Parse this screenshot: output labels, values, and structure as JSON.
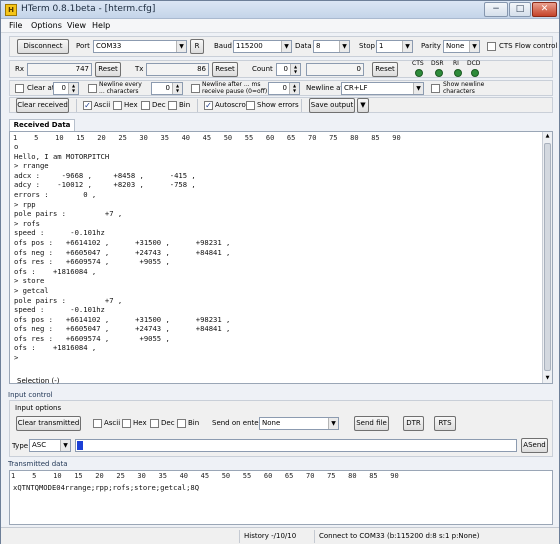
{
  "window": {
    "title": "HTerm 0.8.1beta - [hterm.cfg]",
    "app_icon_glyph": "H",
    "minimize_glyph": "−",
    "maximize_glyph": "□",
    "close_glyph": "✕"
  },
  "menu": [
    "File",
    "Options",
    "View",
    "Help"
  ],
  "connection": {
    "disconnect_label": "Disconnect",
    "port_label": "Port",
    "port_value": "COM33",
    "refresh_label": "R",
    "baud_label": "Baud",
    "baud_value": "115200",
    "data_label": "Data",
    "data_value": "8",
    "stop_label": "Stop",
    "stop_value": "1",
    "parity_label": "Parity",
    "parity_value": "None",
    "cts_flow_label": "CTS Flow control"
  },
  "counters": {
    "rx_label": "Rx",
    "rx_value": "747",
    "rx_reset": "Reset",
    "tx_label": "Tx",
    "tx_value": "86",
    "tx_reset": "Reset",
    "count_label": "Count",
    "count_value": "0",
    "count_display": "0",
    "count_reset": "Reset",
    "leds": [
      "CTS",
      "DSR",
      "RI",
      "DCD"
    ]
  },
  "rx_options": {
    "clear_at_label": "Clear at",
    "clear_at_value": "0",
    "newline_every_label_1": "Newline every",
    "newline_every_label_2": "... characters",
    "newline_every_value": "0",
    "newline_after_label_1": "Newline after ... ms",
    "newline_after_label_2": "receive pause (0=off)",
    "newline_after_value": "0",
    "newline_at_label": "Newline at",
    "newline_at_value": "CR+LF",
    "show_newline_label_1": "Show newline",
    "show_newline_label_2": "characters",
    "clear_received_label": "Clear received",
    "formats": [
      {
        "label": "Ascii",
        "checked": true
      },
      {
        "label": "Hex",
        "checked": false
      },
      {
        "label": "Dec",
        "checked": false
      },
      {
        "label": "Bin",
        "checked": false
      }
    ],
    "autoscroll_label": "Autoscroll",
    "autoscroll_checked": true,
    "show_errors_label": "Show errors",
    "save_output_label": "Save output",
    "check_glyph": "✓"
  },
  "received": {
    "tab_label": "Received Data",
    "ruler": "1    5    10   15   20   25   30   35   40   45   50   55   60   65   70   75   80   85   90",
    "lines": [
      "o",
      "Hello, I am MOTORPITCH",
      "> rrange",
      "adcx :     -9668 ,     +8458 ,      -415 ,",
      "adcy :    -10012 ,     +8203 ,      -758 ,",
      "errors :        0 ,",
      "> rpp",
      "pole pairs :         +7 ,",
      "> rofs",
      "speed :      -0.101hz",
      "ofs pos :   +6614102 ,      +31500 ,      +98231 ,",
      "ofs neg :   +6605047 ,      +24743 ,      +84841 ,",
      "ofs res :   +6609574 ,       +9055 ,",
      "ofs :    +1816084 ,",
      "> store",
      "> getcal",
      "pole pairs :         +7 ,",
      "speed :      -0.101hz",
      "ofs pos :   +6614102 ,      +31500 ,      +98231 ,",
      "ofs neg :   +6605047 ,      +24743 ,      +84841 ,",
      "ofs res :   +6609574 ,       +9055 ,",
      "ofs :    +1816084 ,",
      ">"
    ],
    "selection_label": "Selection (-)"
  },
  "input_control": {
    "section_title": "Input control",
    "options_label": "Input options",
    "clear_transmitted_label": "Clear transmitted",
    "formats": [
      "Ascii",
      "Hex",
      "Dec",
      "Bin"
    ],
    "send_on_enter_label": "Send on enter",
    "send_on_enter_value": "None",
    "send_file_label": "Send file",
    "dtr_label": "DTR",
    "rts_label": "RTS",
    "type_label": "Type",
    "type_value": "ASC",
    "asend_label": "ASend"
  },
  "transmitted": {
    "section_title": "Transmitted data",
    "ruler": "1    5    10   15   20   25   30   35   40   45   50   55   60   65   70   75   80   85   90",
    "line": "xQTNTQMODE04rrange;rpp;rofs;store;getcal;8Q"
  },
  "status": {
    "history": "History -/10/10",
    "connection": "Connect to COM33 (b:115200 d:8 s:1 p:None)"
  },
  "colors": {
    "led_green": "#2e8b3a",
    "cursor_blue": "#1b3fd6",
    "close_red": "#c5432a"
  }
}
